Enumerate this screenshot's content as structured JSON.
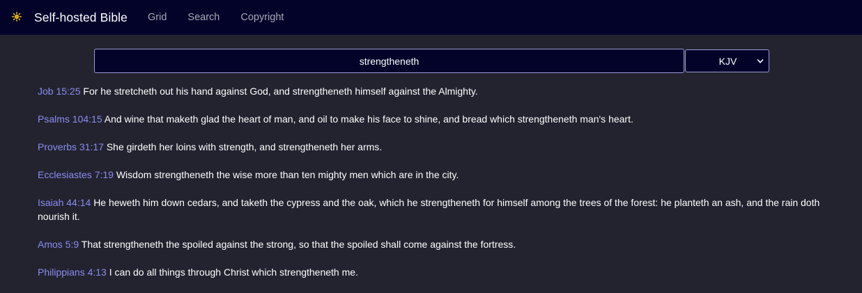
{
  "header": {
    "brand_icon": "sun-icon",
    "brand_title": "Self-hosted Bible",
    "nav": [
      {
        "label": "Grid"
      },
      {
        "label": "Search"
      },
      {
        "label": "Copyright"
      }
    ]
  },
  "search": {
    "query": "strengtheneth",
    "version": "KJV",
    "version_icon": "chevron-down-icon"
  },
  "results": [
    {
      "ref": "Job 15:25",
      "text": "For he stretcheth out his hand against God, and strengtheneth himself against the Almighty."
    },
    {
      "ref": "Psalms 104:15",
      "text": "And wine that maketh glad the heart of man, and oil to make his face to shine, and bread which strengtheneth man's heart."
    },
    {
      "ref": "Proverbs 31:17",
      "text": "She girdeth her loins with strength, and strengtheneth her arms."
    },
    {
      "ref": "Ecclesiastes 7:19",
      "text": "Wisdom strengtheneth the wise more than ten mighty men which are in the city."
    },
    {
      "ref": "Isaiah 44:14",
      "text": "He heweth him down cedars, and taketh the cypress and the oak, which he strengtheneth for himself among the trees of the forest: he planteth an ash, and the rain doth nourish it."
    },
    {
      "ref": "Amos 5:9",
      "text": "That strengtheneth the spoiled against the strong, so that the spoiled shall come against the fortress."
    },
    {
      "ref": "Philippians 4:13",
      "text": "I can do all things through Christ which strengtheneth me."
    }
  ],
  "colors": {
    "navbar_bg": "#03032a",
    "page_bg": "#22232f",
    "link": "#8c8cf0",
    "border": "#9c9bd6",
    "sun": "#f5c518"
  }
}
